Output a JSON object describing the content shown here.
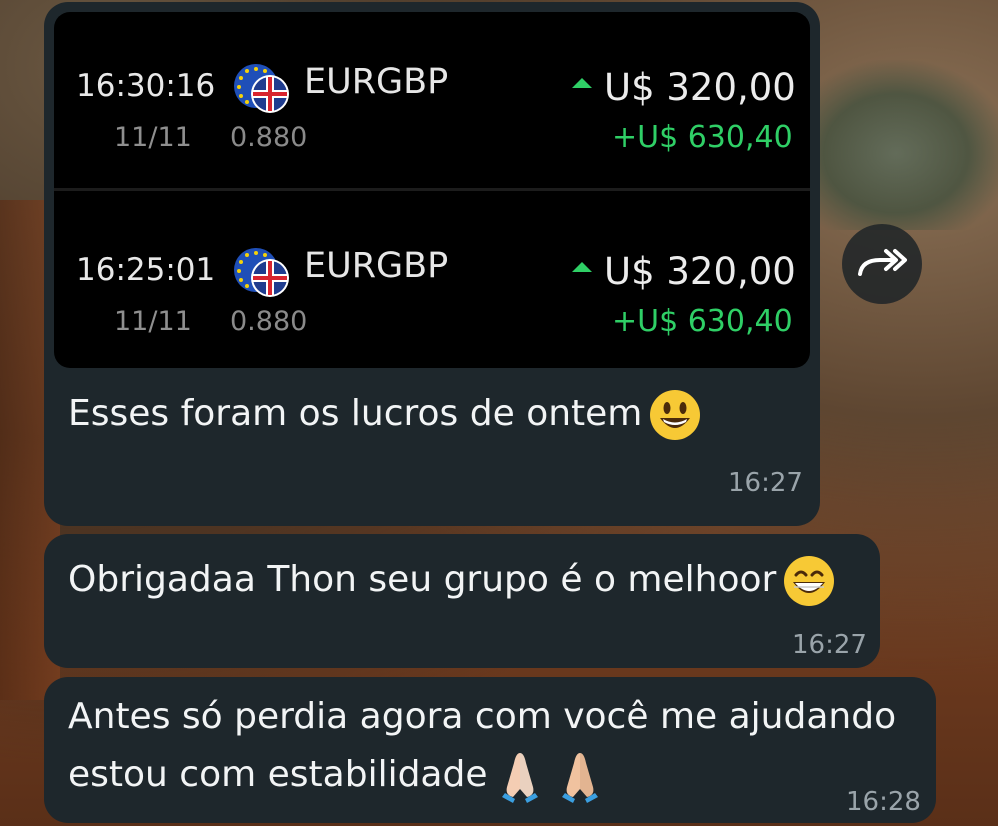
{
  "trades": [
    {
      "time": "16:30:16",
      "date": "11/11",
      "pair": "EURGBP",
      "price": "0.880",
      "amount": "U$ 320,00",
      "profit": "+U$ 630,40"
    },
    {
      "time": "16:25:01",
      "date": "11/11",
      "pair": "EURGBP",
      "price": "0.880",
      "amount": "U$ 320,00",
      "profit": "+U$ 630,40"
    }
  ],
  "messages": [
    {
      "text": "Esses foram os lucros de ontem",
      "time": "16:27",
      "emoji": "grinning-face-emoji"
    },
    {
      "text": "Obrigadaa Thon seu grupo é o melhoor",
      "time": "16:27",
      "emoji": "beaming-face-emoji"
    },
    {
      "text_line1": "Antes só perdia agora com você me ajudando",
      "text_line2": "estou com estabilidade",
      "time": "16:28",
      "emoji": "folded-hands-emoji"
    }
  ],
  "share_icon": "forward-arrow-icon",
  "colors": {
    "bubble": "#1e272c",
    "profit_green": "#2fcf66",
    "trade_bg": "#000000"
  }
}
